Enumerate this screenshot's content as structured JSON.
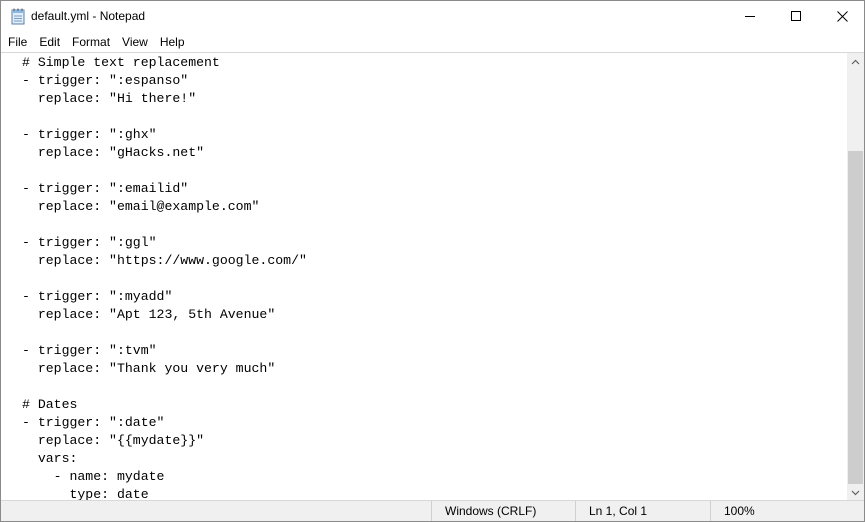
{
  "window": {
    "title": "default.yml - Notepad",
    "icons": {
      "app": "notepad-icon",
      "minimize": "minimize-icon",
      "maximize": "maximize-icon",
      "close": "close-icon"
    }
  },
  "menu": {
    "items": [
      "File",
      "Edit",
      "Format",
      "View",
      "Help"
    ]
  },
  "editor": {
    "lines": [
      "# Simple text replacement",
      "- trigger: \":espanso\"",
      "  replace: \"Hi there!\"",
      "",
      "- trigger: \":ghx\"",
      "  replace: \"gHacks.net\"",
      "",
      "- trigger: \":emailid\"",
      "  replace: \"email@example.com\"",
      "",
      "- trigger: \":ggl\"",
      "  replace: \"https://www.google.com/\"",
      "",
      "- trigger: \":myadd\"",
      "  replace: \"Apt 123, 5th Avenue\"",
      "",
      "- trigger: \":tvm\"",
      "  replace: \"Thank you very much\"",
      "",
      "# Dates",
      "- trigger: \":date\"",
      "  replace: \"{{mydate}}\"",
      "  vars:",
      "    - name: mydate",
      "      type: date"
    ]
  },
  "scrollbar": {
    "up_icon": "chevron-up-icon",
    "down_icon": "chevron-down-icon"
  },
  "status": {
    "encoding": "Windows (CRLF)",
    "position": "Ln 1, Col 1",
    "zoom": "100%"
  }
}
